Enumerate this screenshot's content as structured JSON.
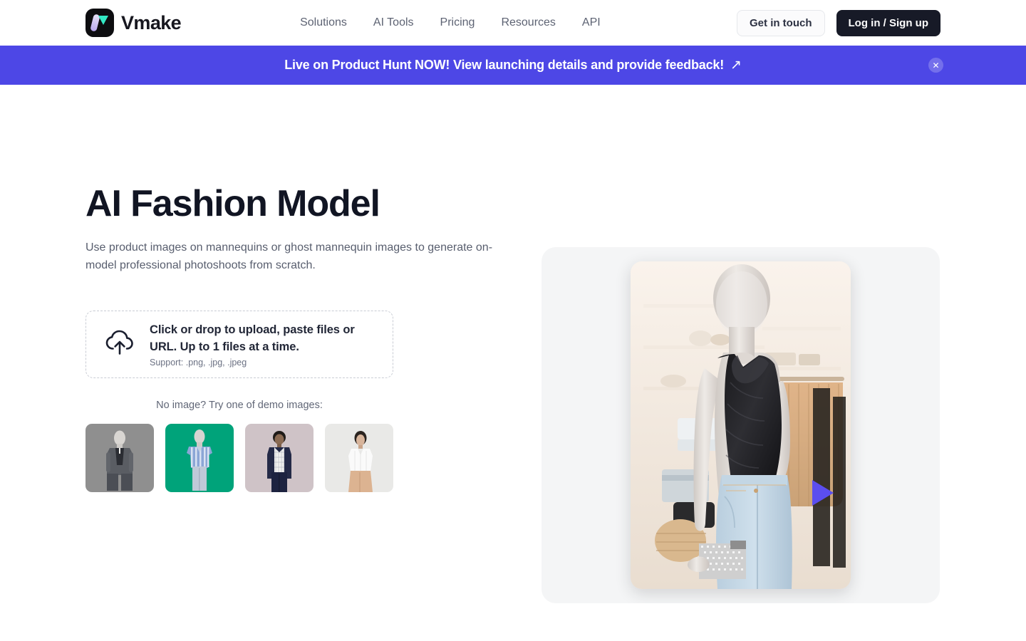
{
  "header": {
    "logo_text": "Vmake",
    "logo_icon": "vmake-logo-icon",
    "nav": [
      {
        "label": "Solutions"
      },
      {
        "label": "AI Tools"
      },
      {
        "label": "Pricing"
      },
      {
        "label": "Resources"
      },
      {
        "label": "API"
      }
    ],
    "get_in_touch_label": "Get in touch",
    "login_label": "Log in / Sign up"
  },
  "banner": {
    "text": "Live on Product Hunt NOW! View launching details and provide feedback!",
    "arrow_icon": "↗",
    "close_icon": "✕",
    "background_color": "#4d47e6"
  },
  "hero": {
    "title": "AI Fashion Model",
    "subtitle": "Use product images on mannequins or ghost mannequin images to generate on-model professional photoshoots from scratch.",
    "cursor_icon": "play-cursor-icon",
    "image_alt": "mannequin-black-draped-top-blue-jeans-boutique"
  },
  "upload": {
    "icon": "cloud-upload-icon",
    "main_text": "Click or drop to upload, paste files or URL. Up to 1 files at a time.",
    "support_text": "Support: .png, .jpg, .jpeg"
  },
  "demo": {
    "label": "No image? Try one of demo images:",
    "thumbnails": [
      {
        "name": "demo-gray-suit-mannequin",
        "bg": "#8f8f8f"
      },
      {
        "name": "demo-teal-striped-shirt-mannequin",
        "bg": "#00a37a"
      },
      {
        "name": "demo-navy-jacket-model",
        "bg": "#cfc3c7"
      },
      {
        "name": "demo-white-blouse-tan-skirt-model",
        "bg": "#e9e9e7"
      }
    ]
  },
  "colors": {
    "accent": "#4d47e6",
    "dark": "#171a27",
    "text_muted": "#5d6373"
  }
}
